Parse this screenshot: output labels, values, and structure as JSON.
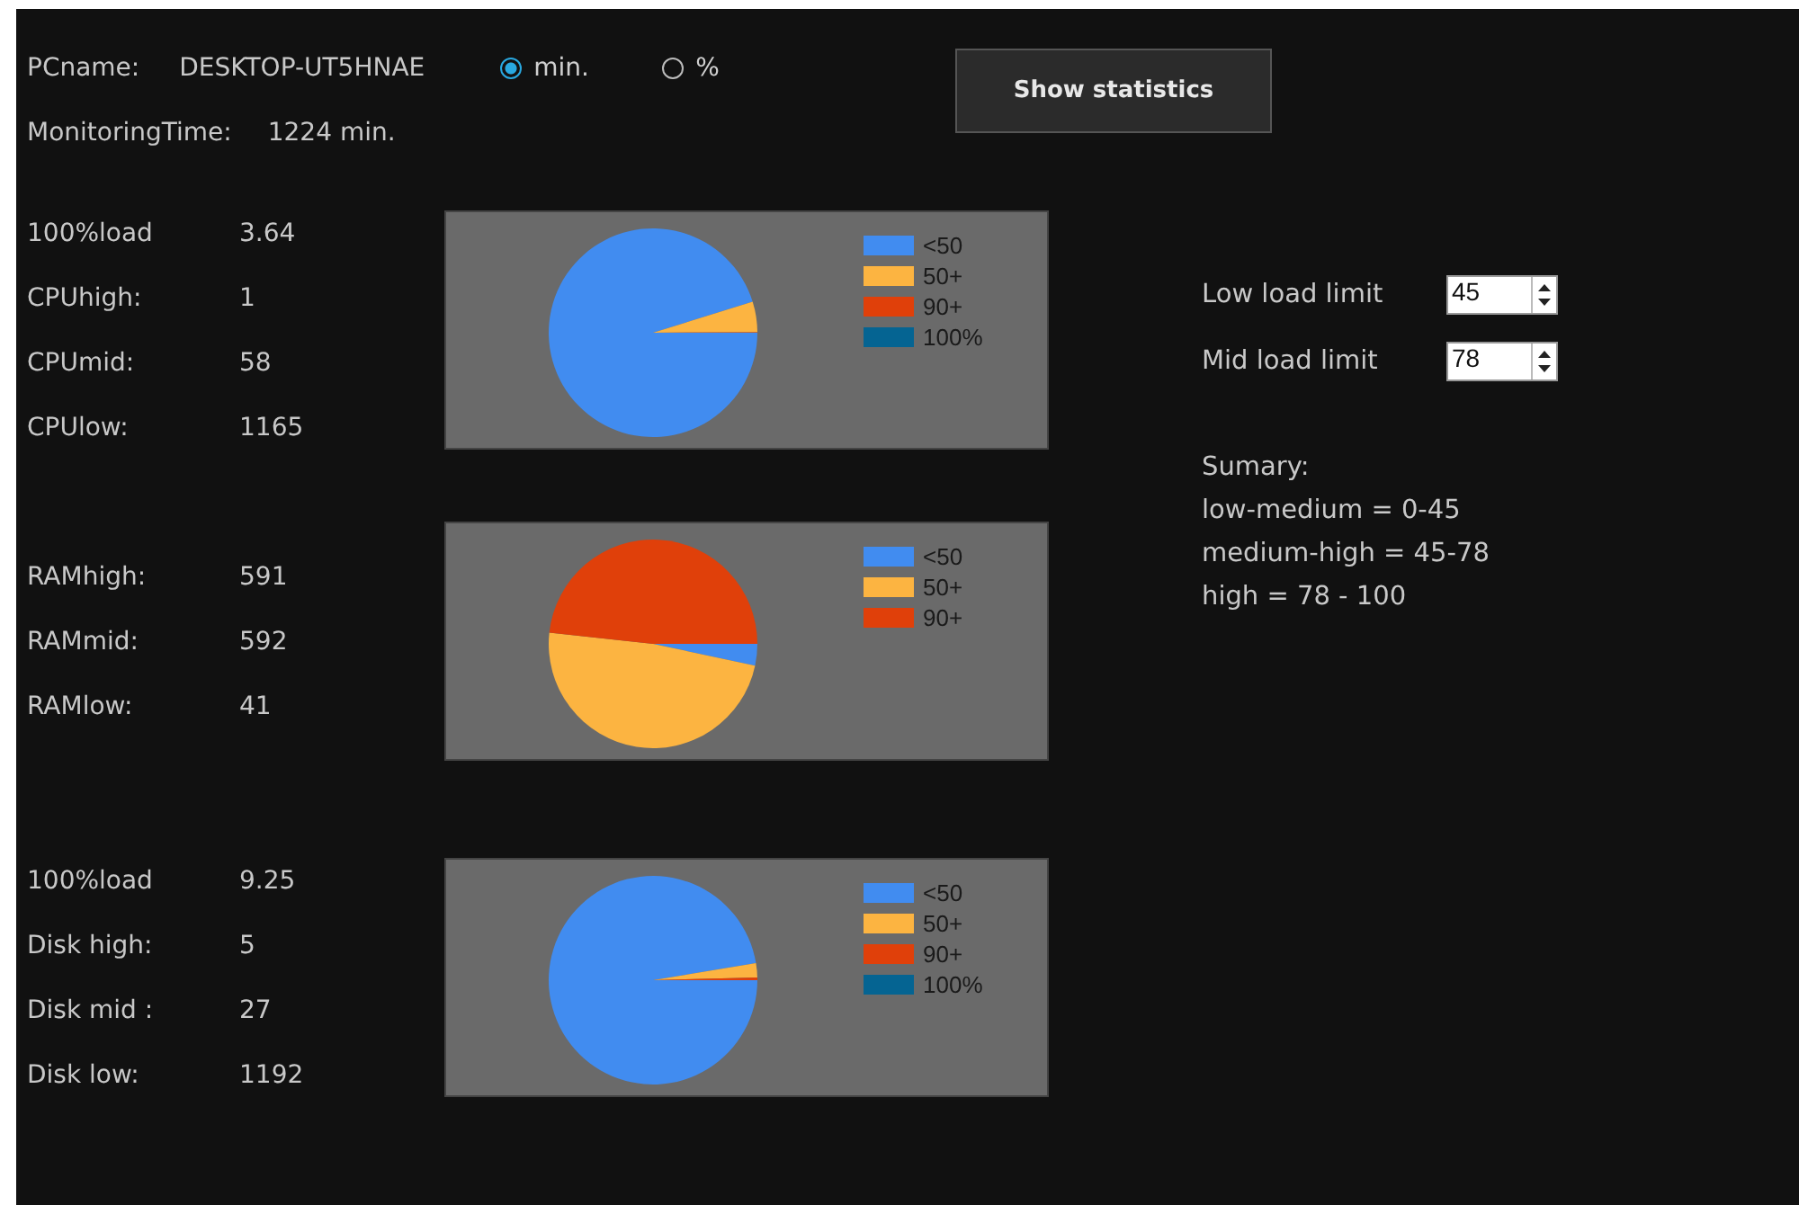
{
  "pc": {
    "label": "PCname:",
    "value": "DESKTOP-UT5HNAE"
  },
  "units": [
    {
      "label": "min.",
      "selected": true
    },
    {
      "label": "%",
      "selected": false
    }
  ],
  "show_statistics_button": "Show statistics",
  "monitoring": {
    "label": "MonitoringTime:",
    "value": "1224 min."
  },
  "sections": [
    {
      "stats": [
        {
          "label": "100%load",
          "value": "3.64"
        },
        {
          "label": "CPUhigh:",
          "value": "1"
        },
        {
          "label": "CPUmid:",
          "value": "58"
        },
        {
          "label": "CPUlow:",
          "value": "1165"
        }
      ],
      "chart_data": {
        "type": "pie",
        "categories": [
          "<50",
          "50+",
          "90+",
          "100%"
        ],
        "series": [
          {
            "values": [
              95.18,
              4.74,
              0.08,
              null
            ]
          }
        ],
        "legend": true
      }
    },
    {
      "stats": [
        {
          "label": "RAMhigh:",
          "value": "591"
        },
        {
          "label": "RAMmid:",
          "value": "592"
        },
        {
          "label": "RAMlow:",
          "value": "41"
        }
      ],
      "chart_data": {
        "type": "pie",
        "categories": [
          "<50",
          "50+",
          "90+"
        ],
        "series": [
          {
            "values": [
              3.35,
              48.37,
              48.28
            ]
          }
        ],
        "legend": true
      }
    },
    {
      "stats": [
        {
          "label": "100%load",
          "value": "9.25"
        },
        {
          "label": "Disk high:",
          "value": "5"
        },
        {
          "label": "Disk mid :",
          "value": "27"
        },
        {
          "label": "Disk low:",
          "value": "1192"
        }
      ],
      "chart_data": {
        "type": "pie",
        "categories": [
          "<50",
          "50+",
          "90+",
          "100%"
        ],
        "series": [
          {
            "values": [
              97.39,
              2.21,
              0.4,
              null
            ]
          }
        ],
        "legend": true
      }
    }
  ],
  "limits": [
    {
      "label": "Low load limit",
      "value": "45"
    },
    {
      "label": "Mid load limit",
      "value": "78"
    }
  ],
  "summary": {
    "title": "Sumary:",
    "lines": [
      "low-medium = 0-45",
      "medium-high = 45-78",
      "high = 78 - 100"
    ]
  }
}
